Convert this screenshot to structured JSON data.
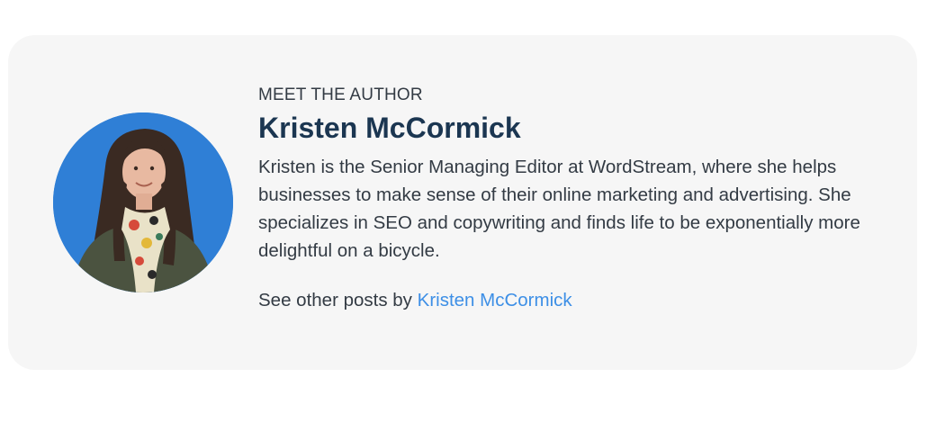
{
  "author_box": {
    "eyebrow": "MEET THE AUTHOR",
    "name": "Kristen McCormick",
    "bio": "Kristen is the Senior Managing Editor at WordStream, where she helps businesses to make sense of their online marketing and advertising. She specializes in SEO and copywriting and finds life to be exponentially more delightful on a bicycle.",
    "more_prefix": "See other posts by",
    "more_link": "Kristen McCormick"
  },
  "colors": {
    "card_background": "#f6f6f6",
    "name": "#1b3651",
    "body_text": "#333b44",
    "link": "#3d8fe6",
    "avatar_background": "#2f7fd6"
  }
}
